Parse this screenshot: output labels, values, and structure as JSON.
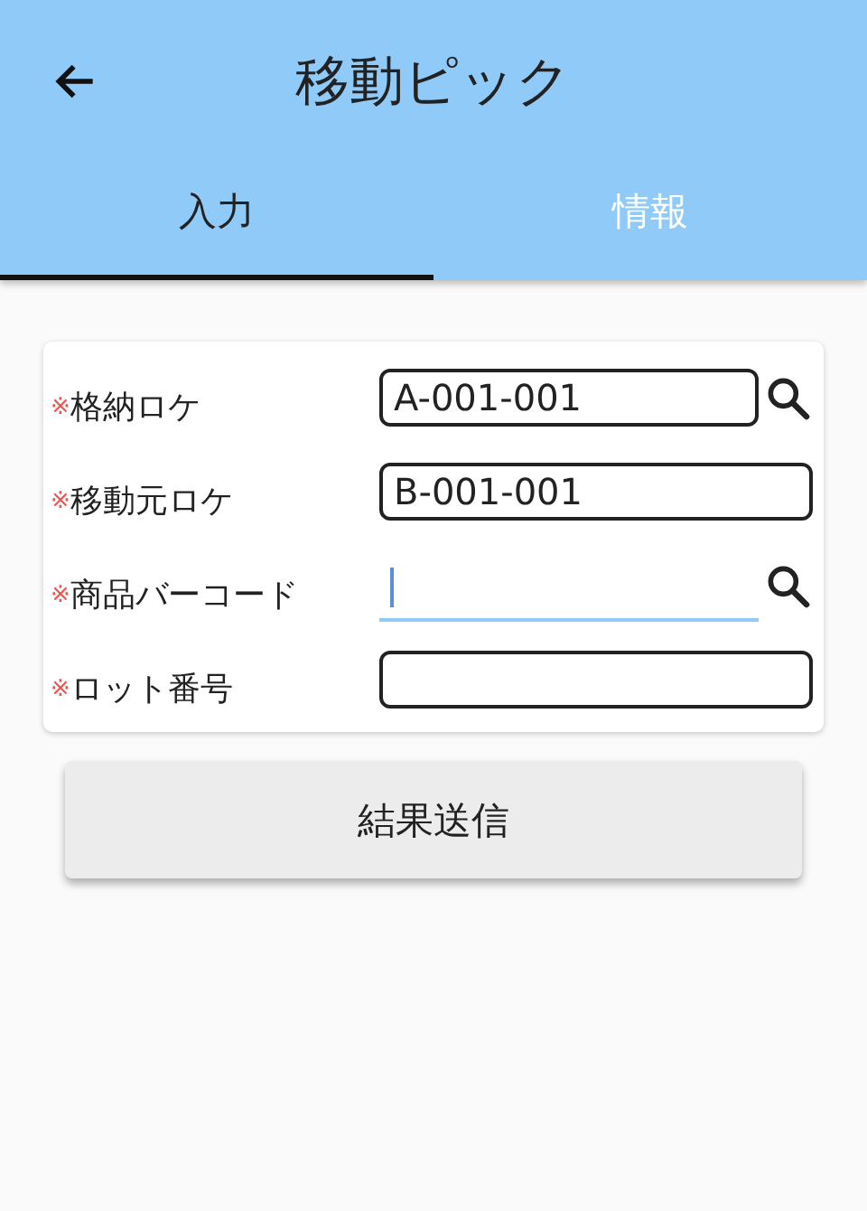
{
  "app_bar": {
    "title": "移動ピック"
  },
  "tabs": [
    {
      "label": "入力",
      "selected": true
    },
    {
      "label": "情報",
      "selected": false
    }
  ],
  "form": {
    "fields": [
      {
        "mark": "※",
        "label": "格納ロケ",
        "kind": "outlined",
        "value": "A-001-001",
        "focused": false,
        "search": true
      },
      {
        "mark": "※",
        "label": "移動元ロケ",
        "kind": "outlined",
        "value": "B-001-001",
        "focused": false,
        "search": false
      },
      {
        "mark": "※",
        "label": "商品バーコード",
        "kind": "underlined",
        "focused": true,
        "search": true
      },
      {
        "mark": "※",
        "label": "ロット番号",
        "kind": "outlined",
        "focused": false,
        "search": false
      }
    ]
  },
  "submit_button": {
    "label": "結果送信"
  }
}
